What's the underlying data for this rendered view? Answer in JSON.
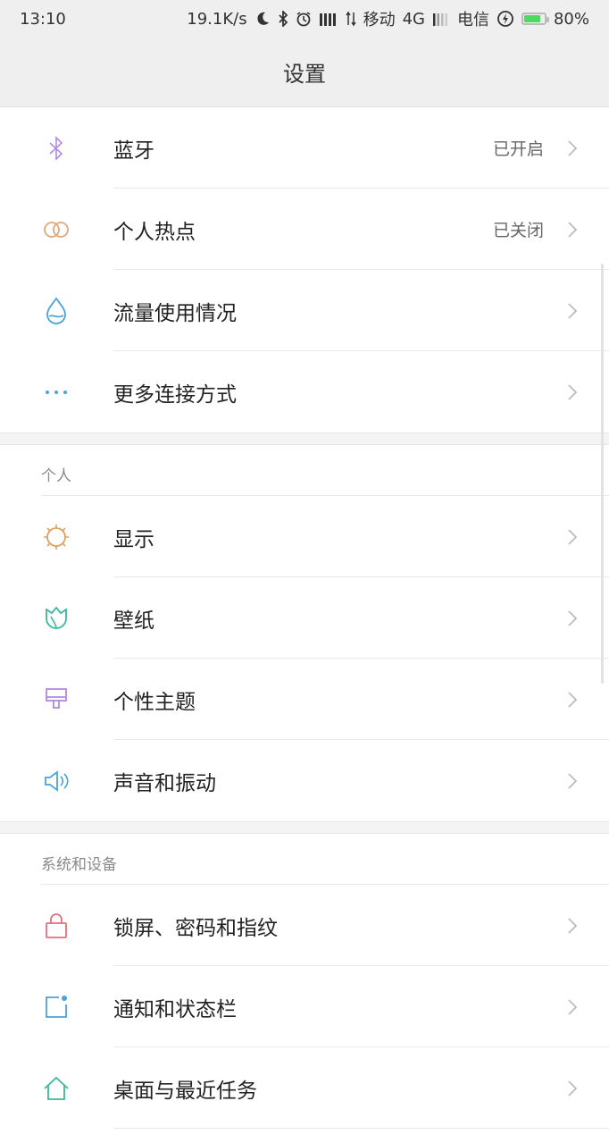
{
  "status_bar": {
    "time": "13:10",
    "speed": "19.1K/s",
    "carrier1": "移动",
    "network": "4G",
    "carrier2": "电信",
    "battery": "80%",
    "battery_level": 0.8,
    "icons": [
      "moon-icon",
      "bluetooth-icon",
      "alarm-icon",
      "signal-icon",
      "data-arrows-icon",
      "signal-weak-icon",
      "charging-icon",
      "battery-icon"
    ]
  },
  "header": {
    "title": "设置"
  },
  "groups": {
    "network": [
      {
        "label": "蓝牙",
        "value": "已开启",
        "icon": "bluetooth-icon",
        "color": "#b18be0"
      },
      {
        "label": "个人热点",
        "value": "已关闭",
        "icon": "hotspot-icon",
        "color": "#e0a77a"
      },
      {
        "label": "流量使用情况",
        "value": "",
        "icon": "data-usage-icon",
        "color": "#4aa3d8"
      },
      {
        "label": "更多连接方式",
        "value": "",
        "icon": "more-icon",
        "color": "#4aa3d8"
      }
    ],
    "personal": {
      "header": "个人",
      "items": [
        {
          "label": "显示",
          "icon": "brightness-icon",
          "color": "#e0a060"
        },
        {
          "label": "壁纸",
          "icon": "wallpaper-icon",
          "color": "#3cb6a0"
        },
        {
          "label": "个性主题",
          "icon": "theme-icon",
          "color": "#b18be0"
        },
        {
          "label": "声音和振动",
          "icon": "speaker-icon",
          "color": "#4aa3d8"
        }
      ]
    },
    "system": {
      "header": "系统和设备",
      "items": [
        {
          "label": "锁屏、密码和指纹",
          "icon": "lock-icon",
          "color": "#e07080"
        },
        {
          "label": "通知和状态栏",
          "icon": "notification-icon",
          "color": "#4aa3d8"
        },
        {
          "label": "桌面与最近任务",
          "icon": "home-icon",
          "color": "#3cb6a0"
        }
      ]
    }
  }
}
